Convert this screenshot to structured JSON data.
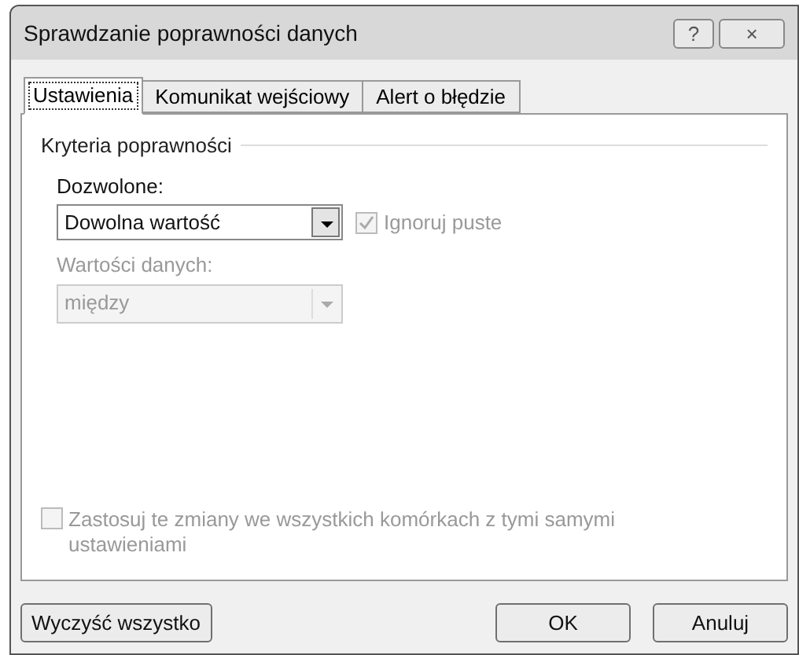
{
  "window": {
    "title": "Sprawdzanie poprawności danych",
    "buttons": [
      "?",
      "×"
    ]
  },
  "tabs": [
    {
      "label": "Ustawienia",
      "selected": true
    },
    {
      "label": "Komunikat wejściowy",
      "selected": false
    },
    {
      "label": "Alert o błędzie",
      "selected": false
    }
  ],
  "group": {
    "title": "Kryteria poprawności"
  },
  "allow": {
    "label": "Dozwolone:",
    "value": "Dowolna wartość",
    "disabled": false
  },
  "ignore_blank": {
    "label": "Ignoruj puste",
    "checked": true,
    "disabled": true
  },
  "data": {
    "label": "Wartości danych:",
    "value": "między",
    "disabled": true
  },
  "apply_all": {
    "label": "Zastosuj te zmiany we wszystkich komórkach z tymi samymi ustawieniami",
    "checked": false,
    "disabled": true
  },
  "buttons": [
    {
      "label": "Wyczyść wszystko",
      "kind": "left"
    },
    {
      "label": "OK",
      "kind": "right"
    },
    {
      "label": "Anuluj",
      "kind": "right"
    }
  ]
}
